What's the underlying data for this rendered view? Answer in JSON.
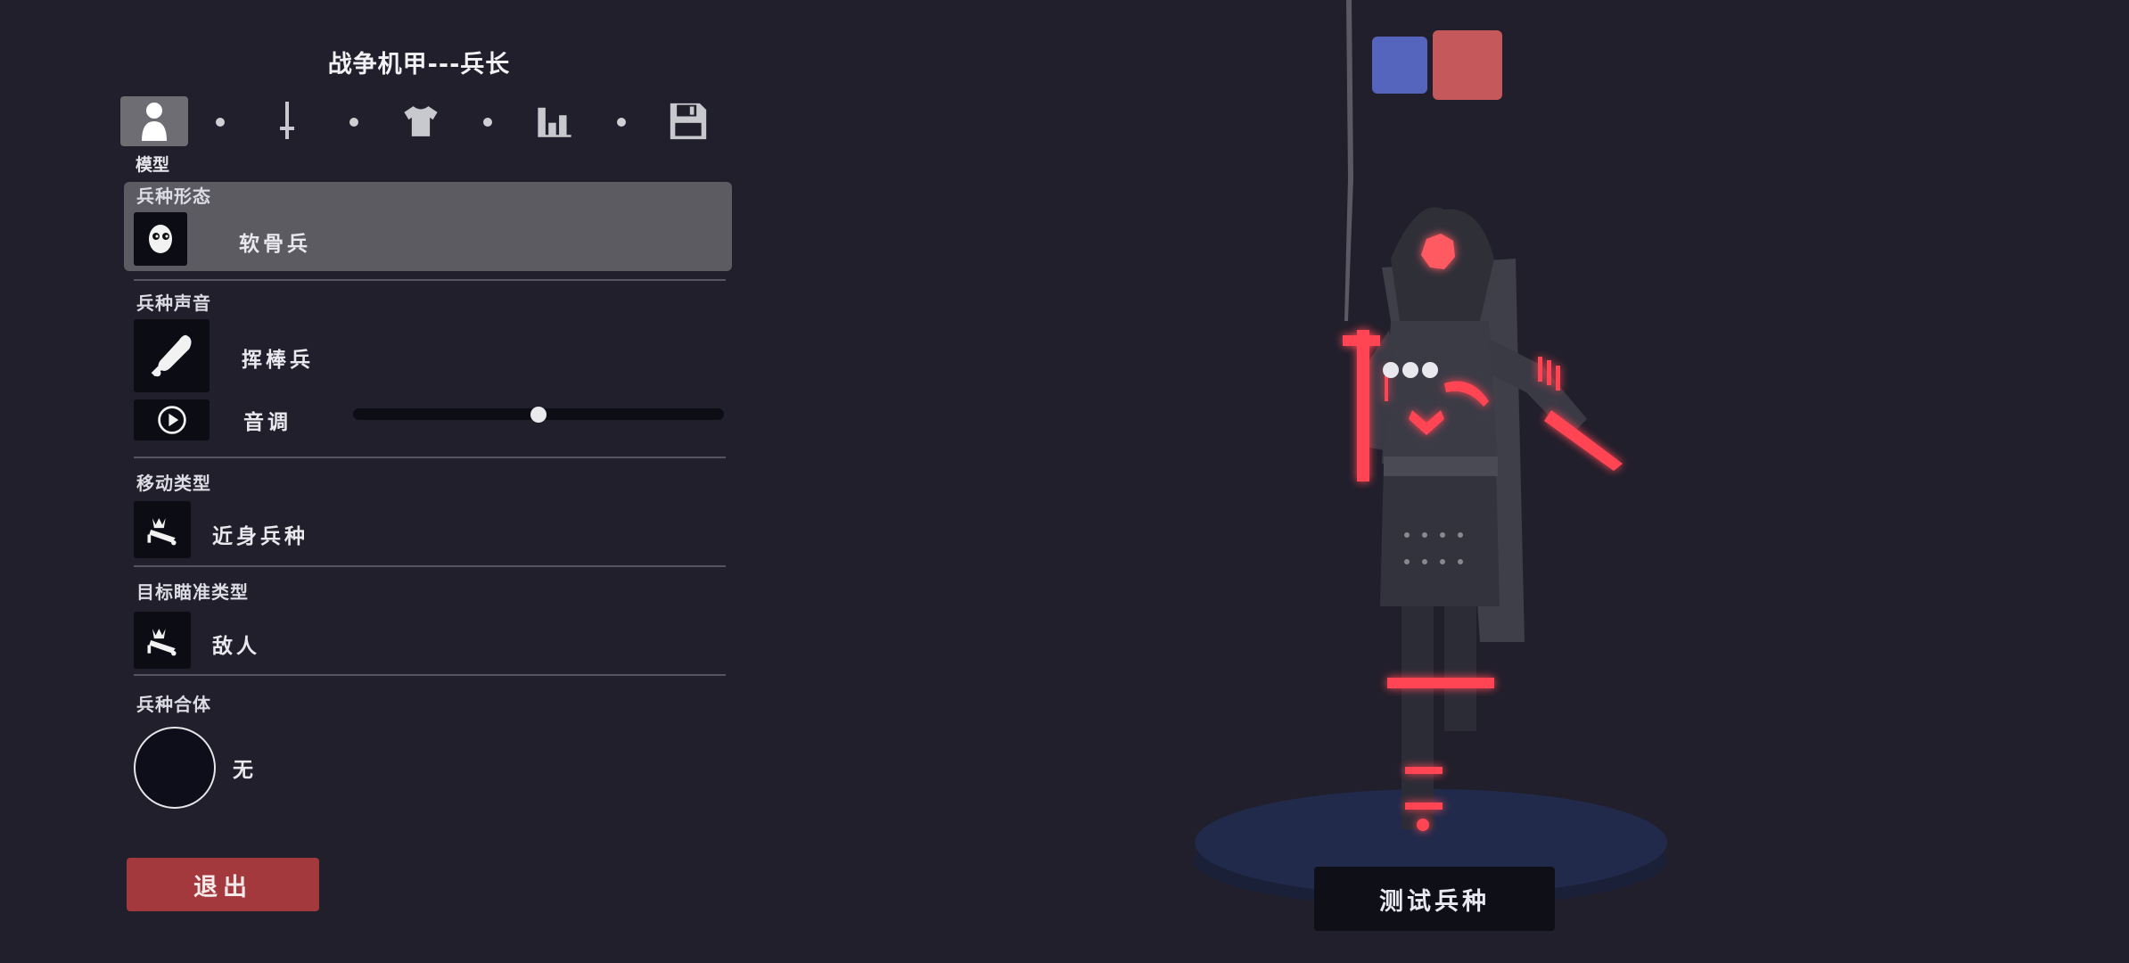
{
  "editor": {
    "title": "战争机甲---兵长",
    "tabs": [
      {
        "icon": "person-icon",
        "active": true
      },
      {
        "icon": "sword-icon",
        "active": false
      },
      {
        "icon": "shirt-icon",
        "active": false
      },
      {
        "icon": "stats-icon",
        "active": false
      },
      {
        "icon": "save-icon",
        "active": false
      }
    ],
    "active_tab_label": "模型"
  },
  "sections": {
    "unit_form": {
      "label": "兵种形态",
      "value": "软骨兵",
      "icon": "mask-face-icon"
    },
    "unit_voice": {
      "label": "兵种声音",
      "value": "挥棒兵",
      "icon": "club-icon"
    },
    "pitch": {
      "label": "音调",
      "value": 0.5,
      "icon": "play-icon"
    },
    "movement": {
      "label": "移动类型",
      "value": "近身兵种",
      "icon": "crown-unit-icon"
    },
    "targeting": {
      "label": "目标瞄准类型",
      "value": "敌人",
      "icon": "crown-unit-icon"
    },
    "combine": {
      "label": "兵种合体",
      "value": "无"
    }
  },
  "buttons": {
    "exit": "退出",
    "test_unit": "测试兵种"
  },
  "team_colors": {
    "blue": "#5564bd",
    "red": "#c5585a"
  },
  "accent_colors": {
    "glow": "#ff3b4a",
    "exit": "#a3393d",
    "background": "#201f2b"
  }
}
